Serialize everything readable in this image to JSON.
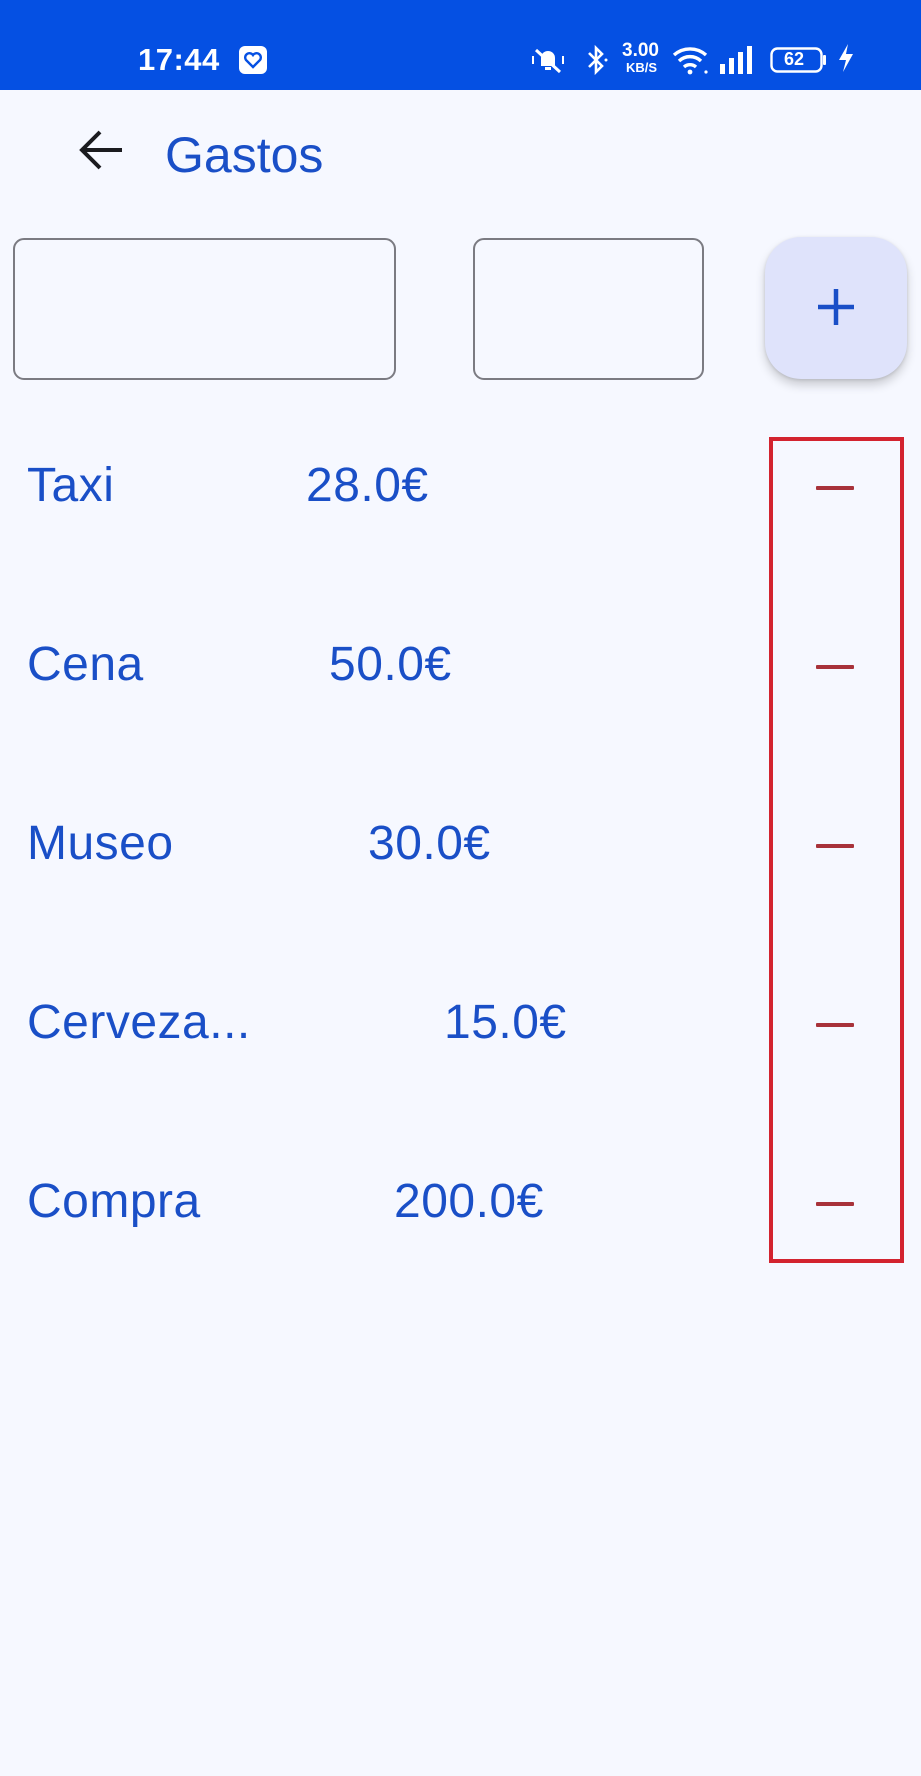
{
  "status_bar": {
    "time": "17:44",
    "net_speed_value": "3.00",
    "net_speed_unit": "KB/S",
    "battery": "62",
    "icons": [
      "heart-app-icon",
      "vibrate-mute-icon",
      "bluetooth-icon",
      "wifi-icon",
      "signal-icon",
      "battery-icon",
      "charging-icon"
    ]
  },
  "app_bar": {
    "title": "Gastos",
    "back_icon": "arrow-left-icon"
  },
  "form": {
    "name_value": "",
    "amount_value": "",
    "add_icon": "plus-icon"
  },
  "expenses": [
    {
      "name": "Taxi",
      "amount": "28.0€"
    },
    {
      "name": "Cena",
      "amount": "50.0€"
    },
    {
      "name": "Museo",
      "amount": "30.0€"
    },
    {
      "name": "Cerveza...",
      "amount": "15.0€"
    },
    {
      "name": "Compra",
      "amount": "200.0€"
    }
  ],
  "colors": {
    "status_bar": "#0550e3",
    "primary_text": "#1a4fc7",
    "remove_icon": "#a8323a",
    "highlight": "#d3232f",
    "background": "#f6f8ff",
    "add_button_bg": "#dfe3fb"
  }
}
